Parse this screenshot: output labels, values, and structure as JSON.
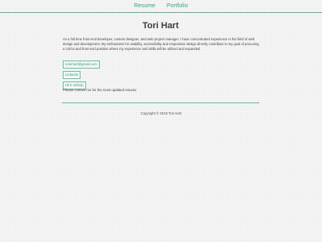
{
  "nav": {
    "items": [
      {
        "label": "Resume"
      },
      {
        "label": "Portfolio"
      }
    ]
  },
  "header": {
    "name": "Tori Hart"
  },
  "intro": {
    "paragraph": "As a full time front-end developer, content designer, and web project manager, I have concentrated experience in the field of web design and development. My enthusiasm for usability, accessibility and responsive design directly contribute to my goal of procuring a UX/UI and front-end position where my experience and skills will be utilized and expanded."
  },
  "links": {
    "email": "toriehart@gmail.com",
    "linkedin": "LinkedIn",
    "github": "HFC Github"
  },
  "contact": {
    "note": "Please contact me for the most updated resume"
  },
  "footer": {
    "copyright": "Copyright © 2018 Tori Hart"
  },
  "colors": {
    "accent": "#2fa57e",
    "border": "#5cb89a",
    "background": "#f4f4f4",
    "text": "#333333"
  }
}
